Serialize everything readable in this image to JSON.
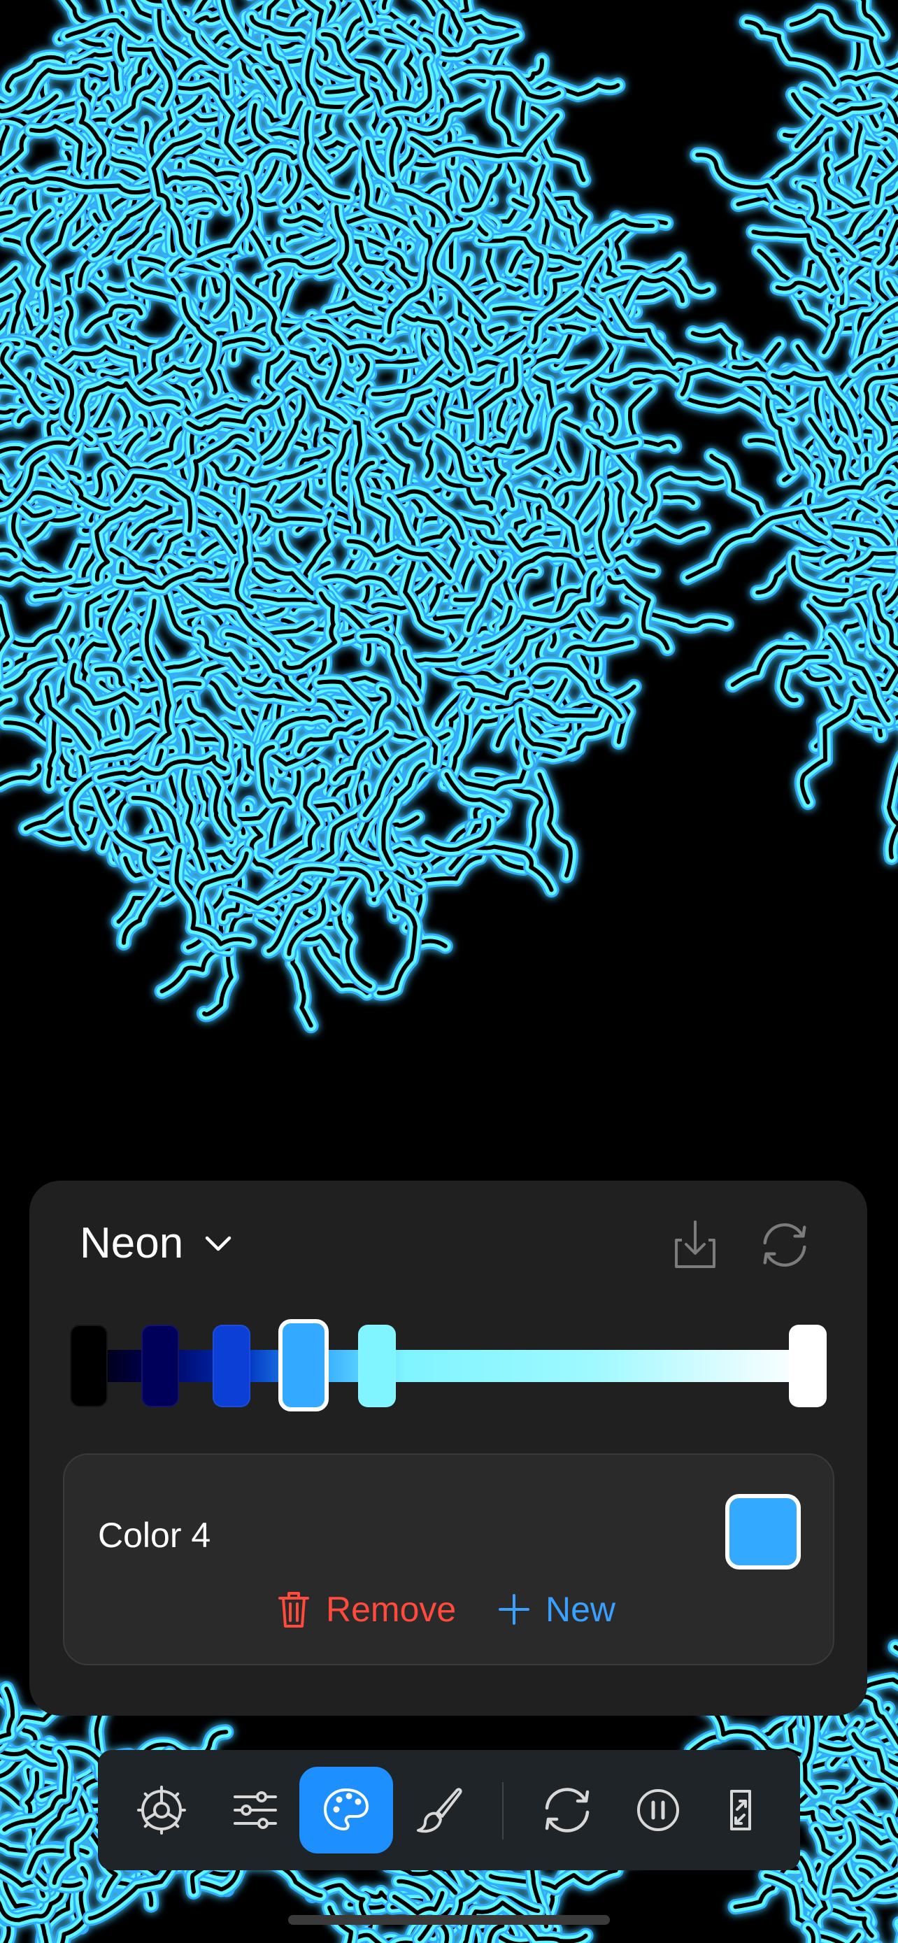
{
  "palette": {
    "name": "Neon",
    "colors": {
      "cyan": "#33aaff",
      "glow": "#5ff6ff",
      "accent_blue": "#1e8fff",
      "remove_red": "#ff4a3c",
      "new_blue": "#3aa0ff"
    },
    "stops": [
      {
        "color": "#000000",
        "selected": false
      },
      {
        "color": "#00005a",
        "selected": false
      },
      {
        "color": "#0b3fd6",
        "selected": false
      },
      {
        "color": "#33aaff",
        "selected": true
      },
      {
        "color": "#80f4ff",
        "selected": false
      },
      {
        "color": "#ffffff",
        "selected": false
      }
    ]
  },
  "editor": {
    "label": "Color 4",
    "remove_label": "Remove",
    "new_label": "New"
  },
  "toolbar": {
    "items": [
      "gear-icon",
      "sliders-icon",
      "palette-icon",
      "brush-icon",
      "refresh-icon",
      "pause-icon",
      "rotate-screen-icon"
    ],
    "active": "palette-icon"
  }
}
